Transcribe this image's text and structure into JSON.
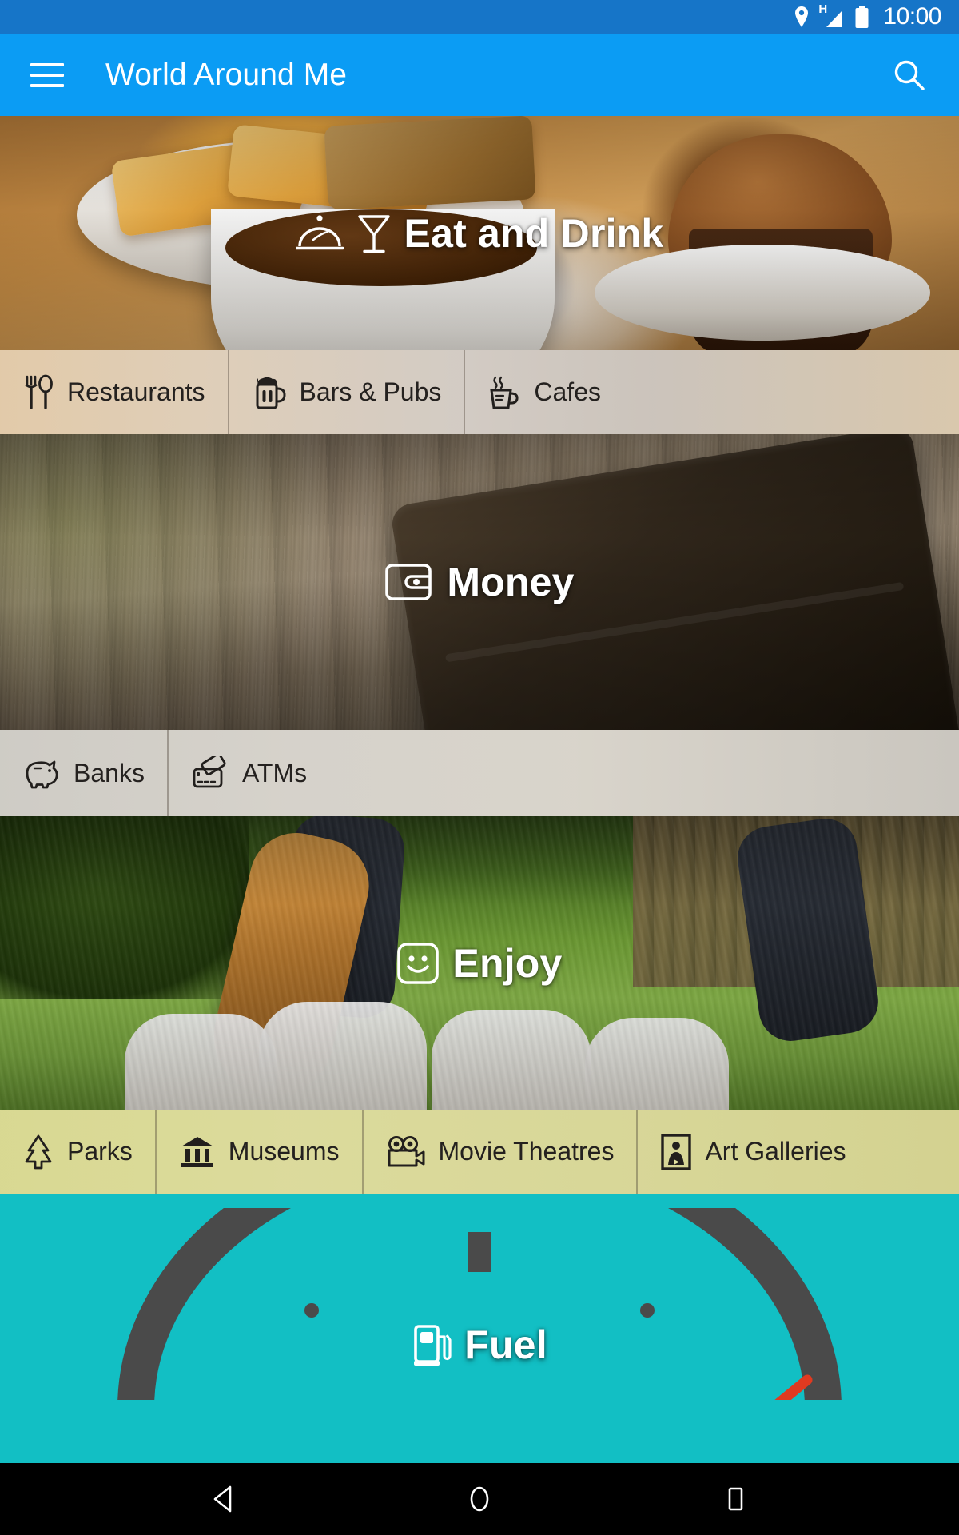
{
  "status_bar": {
    "time": "10:00",
    "network_type": "H",
    "icons": [
      "location-pin-icon",
      "signal-icon",
      "battery-icon"
    ],
    "background_color": "#1675C8"
  },
  "app_bar": {
    "title": "World Around Me",
    "menu_icon": "hamburger-menu-icon",
    "search_icon": "search-icon",
    "background_color": "#0B9CF4",
    "text_color": "#FFFFFF"
  },
  "categories": [
    {
      "id": "eat-and-drink",
      "title": "Eat and Drink",
      "icons": [
        "food-cloche-icon",
        "cocktail-glass-icon"
      ],
      "subcategories": [
        {
          "label": "Restaurants",
          "icon": "fork-and-spoon-icon"
        },
        {
          "label": "Bars & Pubs",
          "icon": "beer-mug-icon"
        },
        {
          "label": "Cafes",
          "icon": "coffee-cup-icon"
        }
      ]
    },
    {
      "id": "money",
      "title": "Money",
      "icons": [
        "wallet-icon"
      ],
      "subcategories": [
        {
          "label": "Banks",
          "icon": "piggy-bank-icon"
        },
        {
          "label": "ATMs",
          "icon": "payment-cards-icon"
        }
      ]
    },
    {
      "id": "enjoy",
      "title": "Enjoy",
      "icons": [
        "smiley-face-icon"
      ],
      "subcategories": [
        {
          "label": "Parks",
          "icon": "tree-icon"
        },
        {
          "label": "Museums",
          "icon": "museum-building-icon"
        },
        {
          "label": "Movie Theatres",
          "icon": "film-camera-icon"
        },
        {
          "label": "Art Galleries",
          "icon": "framed-painting-icon"
        }
      ]
    },
    {
      "id": "fuel",
      "title": "Fuel",
      "icons": [
        "fuel-pump-icon"
      ],
      "background_color": "#12BFC4",
      "gauge": {
        "arc_color": "#4A4A4A",
        "needle_color": "#E03A20"
      },
      "subcategories": []
    }
  ],
  "nav_bar": {
    "back_label": "back-button",
    "home_label": "home-button",
    "recents_label": "recents-button",
    "background_color": "#000000"
  }
}
